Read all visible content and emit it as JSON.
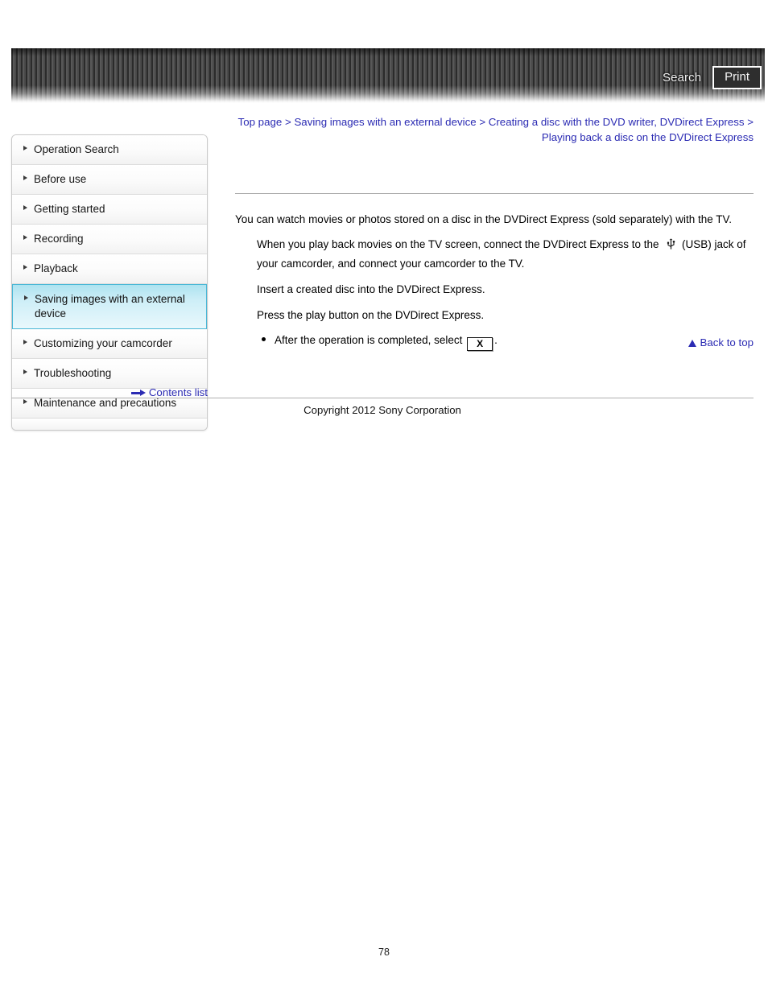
{
  "header": {
    "search_label": "Search",
    "print_label": "Print",
    "banner_color": "#2b2b2b"
  },
  "breadcrumb": {
    "separator": ">",
    "items": [
      {
        "label": "Top page"
      },
      {
        "label": "Saving images with an external device"
      },
      {
        "label": "Creating a disc with the DVD writer, DVDirect Express"
      },
      {
        "label": "Playing back a disc on the DVDirect Express"
      }
    ],
    "link_color": "#2b2bb3"
  },
  "sidebar": {
    "items": [
      {
        "label": "Operation Search",
        "selected": false
      },
      {
        "label": "Before use",
        "selected": false
      },
      {
        "label": "Getting started",
        "selected": false
      },
      {
        "label": "Recording",
        "selected": false
      },
      {
        "label": "Playback",
        "selected": false
      },
      {
        "label": "Saving images with an external device",
        "selected": true
      },
      {
        "label": "Customizing your camcorder",
        "selected": false
      },
      {
        "label": "Troubleshooting",
        "selected": false
      },
      {
        "label": "Maintenance and precautions",
        "selected": false
      }
    ],
    "contents_list_label": "Contents list",
    "highlight_color": "#aee3f0",
    "highlight_border_color": "#49b7d6"
  },
  "content": {
    "lead": "You can watch movies or photos stored on a disc in the DVDirect Express (sold separately) with the TV.",
    "step1_a": "When you play back movies on the TV screen, connect the DVDirect Express to the",
    "step1_b": "(USB) jack of your camcorder, and connect your camcorder to the TV.",
    "step2": "Insert a created disc into the DVDirect Express.",
    "step3": "Press the play button on the DVDirect Express.",
    "note_a": "After the operation is completed, select",
    "note_b": ".",
    "x_key_label": "X",
    "back_to_top_label": "Back to top"
  },
  "footer": {
    "copyright": "Copyright 2012 Sony Corporation",
    "page_number": "78"
  }
}
